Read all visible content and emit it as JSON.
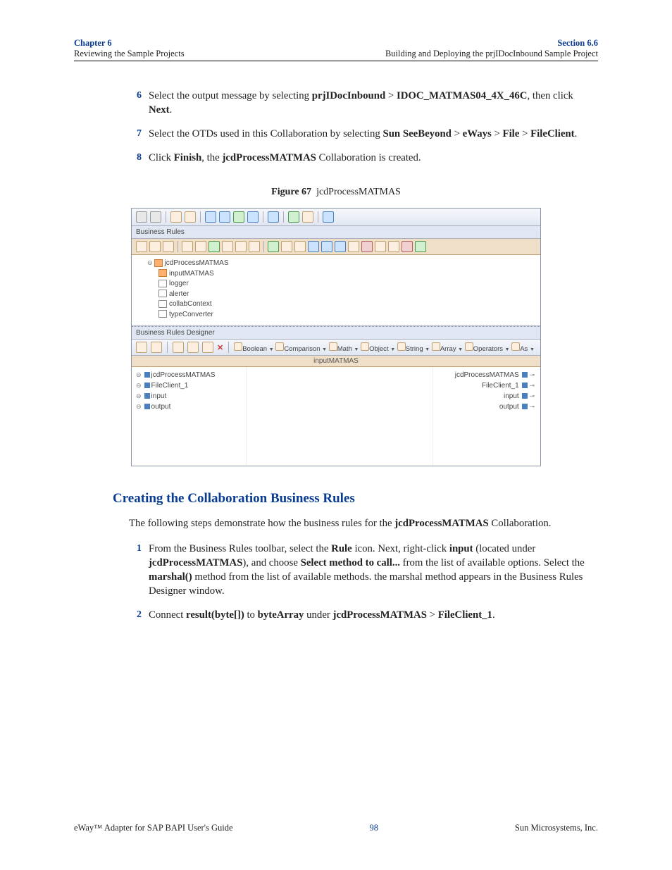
{
  "header": {
    "chapter": "Chapter 6",
    "chapter_sub": "Reviewing the Sample Projects",
    "section": "Section 6.6",
    "section_sub": "Building and Deploying the prjIDocInbound Sample Project"
  },
  "steps_a": [
    {
      "num": "6",
      "parts": [
        "Select the output message by selecting ",
        {
          "b": "prjIDocInbound"
        },
        " > ",
        {
          "b": "IDOC_MATMAS04_4X_46C"
        },
        ", then click ",
        {
          "b": "Next"
        },
        "."
      ]
    },
    {
      "num": "7",
      "parts": [
        "Select the OTDs used in this Collaboration by selecting ",
        {
          "b": "Sun SeeBeyond"
        },
        " > ",
        {
          "b": "eWays"
        },
        " > ",
        {
          "b": "File"
        },
        " > ",
        {
          "b": "FileClient"
        },
        "."
      ]
    },
    {
      "num": "8",
      "parts": [
        "Click ",
        {
          "b": "Finish"
        },
        ", the ",
        {
          "b": "jcdProcessMATMAS"
        },
        " Collaboration is created."
      ]
    }
  ],
  "figure": {
    "label": "Figure 67",
    "caption": "jcdProcessMATMAS"
  },
  "screenshot": {
    "panel1": "Business Rules",
    "tree": {
      "root": "jcdProcessMATMAS",
      "children": [
        "inputMATMAS",
        "logger",
        "alerter",
        "collabContext",
        "typeConverter"
      ]
    },
    "panel2": "Business Rules Designer",
    "designer_menus": [
      "Boolean",
      "Comparison",
      "Math",
      "Object",
      "String",
      "Array",
      "Operators",
      "As"
    ],
    "designer_sub": "inputMATMAS",
    "left_items": [
      "jcdProcessMATMAS",
      "FileClient_1",
      "input",
      "output"
    ],
    "right_items": [
      "jcdProcessMATMAS",
      "FileClient_1",
      "input",
      "output"
    ]
  },
  "section_title": "Creating the Collaboration Business Rules",
  "para1_parts": [
    "The following steps demonstrate how the business rules for the ",
    {
      "b": "jcdProcessMATMAS"
    },
    " Collaboration."
  ],
  "steps_b": [
    {
      "num": "1",
      "parts": [
        "From the Business Rules toolbar, select the ",
        {
          "b": "Rule"
        },
        " icon. Next, right-click ",
        {
          "b": "input"
        },
        " (located under ",
        {
          "b": "jcdProcessMATMAS"
        },
        "), and choose ",
        {
          "b": "Select method to call..."
        },
        " from the list of available options. Select the ",
        {
          "b": "marshal()"
        },
        " method from the list of available methods. the marshal method appears in the Business Rules Designer window."
      ]
    },
    {
      "num": "2",
      "parts": [
        "Connect ",
        {
          "b": "result(byte[])"
        },
        " to ",
        {
          "b": "byteArray"
        },
        " under ",
        {
          "b": "jcdProcessMATMAS"
        },
        " > ",
        {
          "b": "FileClient_1"
        },
        "."
      ]
    }
  ],
  "footer": {
    "left": "eWay™ Adapter for SAP BAPI User's Guide",
    "mid": "98",
    "right": "Sun Microsystems, Inc."
  }
}
